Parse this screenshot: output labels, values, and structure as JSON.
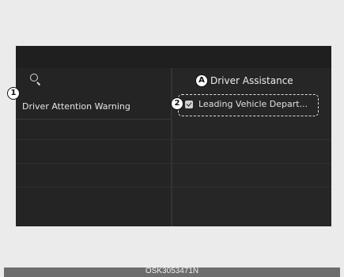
{
  "search": {
    "icon": "search-icon"
  },
  "left_menu": {
    "items": [
      {
        "label": "Driver Attention Warning"
      }
    ]
  },
  "right_panel": {
    "title": "Driver Assistance",
    "items": [
      {
        "label": "Leading Vehicle Depart...",
        "checked": true,
        "icon": "check-icon"
      }
    ]
  },
  "callouts": {
    "one": "1",
    "two": "2",
    "a": "A"
  },
  "footer": {
    "code": "OSK3053471N"
  }
}
